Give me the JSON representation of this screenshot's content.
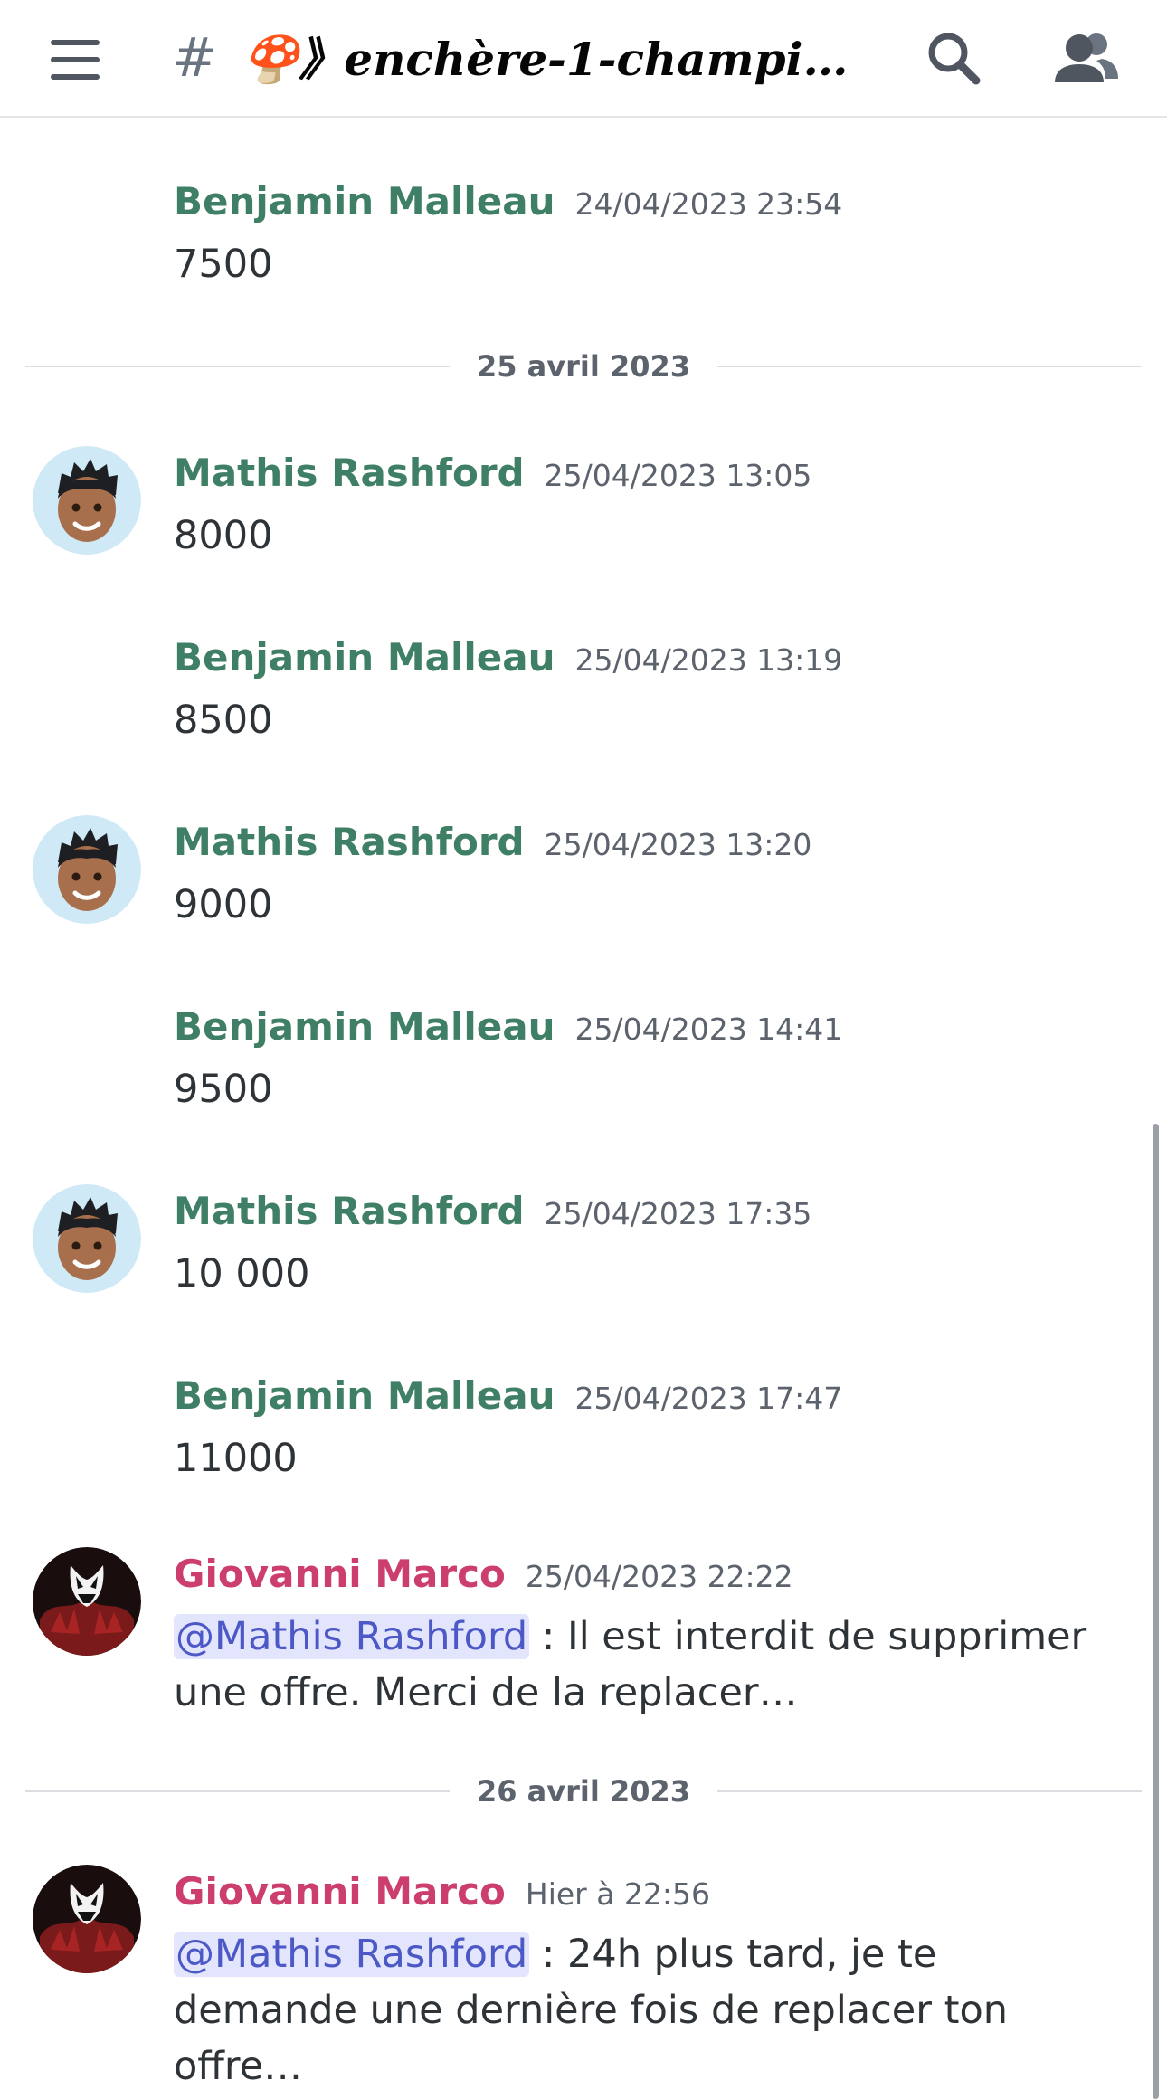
{
  "header": {
    "hash": "#",
    "channel_name": "🍄》enchère-1-champig...",
    "icons": [
      "menu-icon",
      "search-icon",
      "members-icon"
    ]
  },
  "colors": {
    "author_green": "#3f7f65",
    "author_pink": "#cc3e6e",
    "mention_bg": "#e2e5fc",
    "mention_text": "#4d58c7"
  },
  "messages": [
    {
      "author": "Benjamin Malleau",
      "time": "24/04/2023 23:54",
      "text": "7500"
    },
    {
      "author": "Mathis Rashford",
      "time": "25/04/2023 13:05",
      "text": "8000"
    },
    {
      "author": "Benjamin Malleau",
      "time": "25/04/2023 13:19",
      "text": "8500"
    },
    {
      "author": "Mathis Rashford",
      "time": "25/04/2023 13:20",
      "text": "9000"
    },
    {
      "author": "Benjamin Malleau",
      "time": "25/04/2023 14:41",
      "text": "9500"
    },
    {
      "author": "Mathis Rashford",
      "time": "25/04/2023 17:35",
      "text": "10 000"
    },
    {
      "author": "Benjamin Malleau",
      "time": "25/04/2023 17:47",
      "text": "11000"
    },
    {
      "author": "Giovanni Marco",
      "time": "25/04/2023 22:22",
      "mention": "@Mathis Rashford",
      "text": " : Il est interdit de supprimer une offre. Merci de la replacer…"
    },
    {
      "author": "Giovanni Marco",
      "time": "Hier à 22:56",
      "mention": "@Mathis Rashford",
      "text": " : 24h plus tard, je te demande une dernière fois de replacer ton offre…"
    }
  ],
  "dividers": [
    "25 avril 2023",
    "26 avril 2023"
  ]
}
